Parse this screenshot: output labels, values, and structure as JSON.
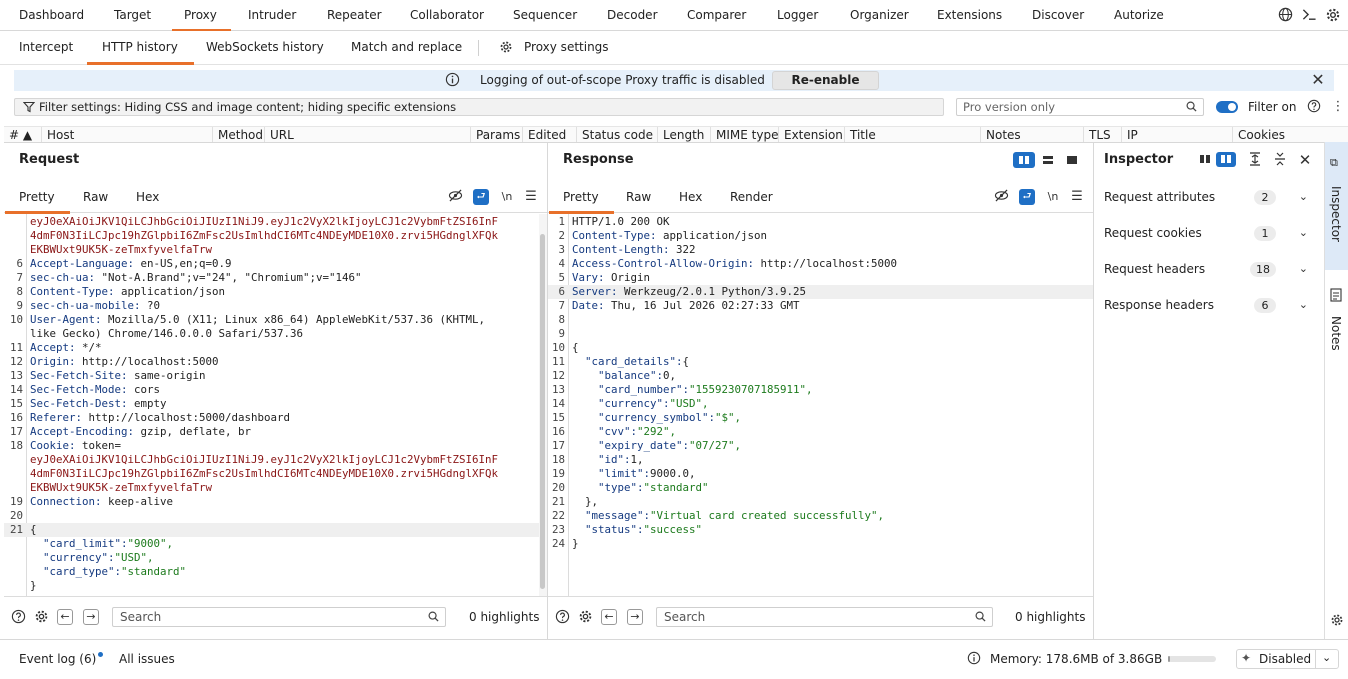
{
  "top_tabs": [
    "Dashboard",
    "Target",
    "Proxy",
    "Intruder",
    "Repeater",
    "Collaborator",
    "Sequencer",
    "Decoder",
    "Comparer",
    "Logger",
    "Organizer",
    "Extensions",
    "Discover",
    "Autorize"
  ],
  "sub_tabs": {
    "intercept": "Intercept",
    "http_history": "HTTP history",
    "websockets": "WebSockets history",
    "match_replace": "Match and replace",
    "proxy_settings": "Proxy settings"
  },
  "banner": {
    "message": "Logging of out-of-scope Proxy traffic is disabled",
    "button": "Re-enable"
  },
  "filter": {
    "label": "Filter settings: Hiding CSS and image content; hiding specific extensions",
    "pro_placeholder": "Pro version only",
    "filter_on": "Filter on"
  },
  "columns": [
    "#",
    "Host",
    "Method",
    "URL",
    "Params",
    "Edited",
    "Status code",
    "Length",
    "MIME type",
    "Extension",
    "Title",
    "Notes",
    "TLS",
    "IP",
    "Cookies"
  ],
  "request": {
    "title": "Request",
    "tabs": {
      "pretty": "Pretty",
      "raw": "Raw",
      "hex": "Hex"
    },
    "newline_icon": "\\n",
    "lines": [
      {
        "n": "",
        "k": "",
        "v": "eyJ0eXAiOiJKV1QiLCJhbGciOiJIUzI1NiJ9.eyJ1c2VyX2lkIjoyLCJ1c2VybmFtZSI6InF",
        "type": "tok"
      },
      {
        "n": "",
        "k": "",
        "v": "4dmF0N3IiLCJpc19hZGlpbiI6ZmFsc2UsImlhdCI6MTc4NDEyMDE10X0.zrvi5HGdnglXFQk",
        "type": "tok"
      },
      {
        "n": "",
        "k": "",
        "v": "EKBWUxt9UK5K-zeTmxfyvelfaTrw",
        "type": "tok"
      },
      {
        "n": "6",
        "k": "Accept-Language:",
        "v": " en-US,en;q=0.9",
        "type": "h"
      },
      {
        "n": "7",
        "k": "sec-ch-ua:",
        "v": " \"Not-A.Brand\";v=\"24\", \"Chromium\";v=\"146\"",
        "type": "h"
      },
      {
        "n": "8",
        "k": "Content-Type:",
        "v": " application/json",
        "type": "h"
      },
      {
        "n": "9",
        "k": "sec-ch-ua-mobile:",
        "v": " ?0",
        "type": "h"
      },
      {
        "n": "10",
        "k": "User-Agent:",
        "v": " Mozilla/5.0 (X11; Linux x86_64) AppleWebKit/537.36 (KHTML,",
        "type": "h"
      },
      {
        "n": "",
        "k": "",
        "v": "like Gecko) Chrome/146.0.0.0 Safari/537.36",
        "type": "p"
      },
      {
        "n": "11",
        "k": "Accept:",
        "v": " */*",
        "type": "h"
      },
      {
        "n": "12",
        "k": "Origin:",
        "v": " http://localhost:5000",
        "type": "h"
      },
      {
        "n": "13",
        "k": "Sec-Fetch-Site:",
        "v": " same-origin",
        "type": "h"
      },
      {
        "n": "14",
        "k": "Sec-Fetch-Mode:",
        "v": " cors",
        "type": "h"
      },
      {
        "n": "15",
        "k": "Sec-Fetch-Dest:",
        "v": " empty",
        "type": "h"
      },
      {
        "n": "16",
        "k": "Referer:",
        "v": " http://localhost:5000/dashboard",
        "type": "h"
      },
      {
        "n": "17",
        "k": "Accept-Encoding:",
        "v": " gzip, deflate, br",
        "type": "h"
      },
      {
        "n": "18",
        "k": "Cookie:",
        "v": " token=",
        "type": "h"
      },
      {
        "n": "",
        "k": "",
        "v": "eyJ0eXAiOiJKV1QiLCJhbGciOiJIUzI1NiJ9.eyJ1c2VyX2lkIjoyLCJ1c2VybmFtZSI6InF",
        "type": "tok"
      },
      {
        "n": "",
        "k": "",
        "v": "4dmF0N3IiLCJpc19hZGlpbiI6ZmFsc2UsImlhdCI6MTc4NDEyMDE10X0.zrvi5HGdnglXFQk",
        "type": "tok"
      },
      {
        "n": "",
        "k": "",
        "v": "EKBWUxt9UK5K-zeTmxfyvelfaTrw",
        "type": "tok"
      },
      {
        "n": "19",
        "k": "Connection:",
        "v": " keep-alive",
        "type": "h"
      },
      {
        "n": "20",
        "k": "",
        "v": "",
        "type": "p"
      },
      {
        "n": "21",
        "k": "",
        "v": "{",
        "type": "p"
      },
      {
        "n": "",
        "k": "  \"card_limit\":",
        "v": "\"9000\",",
        "type": "j"
      },
      {
        "n": "",
        "k": "  \"currency\":",
        "v": "\"USD\",",
        "type": "j"
      },
      {
        "n": "",
        "k": "  \"card_type\":",
        "v": "\"standard\"",
        "type": "j"
      },
      {
        "n": "",
        "k": "",
        "v": "}",
        "type": "p"
      }
    ],
    "search_placeholder": "Search",
    "highlights": "0 highlights"
  },
  "response": {
    "title": "Response",
    "tabs": {
      "pretty": "Pretty",
      "raw": "Raw",
      "hex": "Hex",
      "render": "Render"
    },
    "newline_icon": "\\n",
    "lines": [
      {
        "n": "1",
        "k": "",
        "v": "HTTP/1.0 200 OK",
        "type": "p"
      },
      {
        "n": "2",
        "k": "Content-Type:",
        "v": " application/json",
        "type": "h"
      },
      {
        "n": "3",
        "k": "Content-Length:",
        "v": " 322",
        "type": "h"
      },
      {
        "n": "4",
        "k": "Access-Control-Allow-Origin:",
        "v": " http://localhost:5000",
        "type": "h"
      },
      {
        "n": "5",
        "k": "Vary:",
        "v": " Origin",
        "type": "h"
      },
      {
        "n": "6",
        "k": "Server:",
        "v": " Werkzeug/2.0.1 Python/3.9.25",
        "type": "h"
      },
      {
        "n": "7",
        "k": "Date:",
        "v": " Thu, 16 Jul 2026 02:27:33 GMT",
        "type": "h"
      },
      {
        "n": "8",
        "k": "",
        "v": "",
        "type": "p"
      },
      {
        "n": "9",
        "k": "",
        "v": "",
        "type": "p"
      },
      {
        "n": "10",
        "k": "",
        "v": "{",
        "type": "p"
      },
      {
        "n": "11",
        "k": "  \"card_details\":",
        "v": "{",
        "type": "jp"
      },
      {
        "n": "12",
        "k": "    \"balance\":",
        "v": "0,",
        "type": "jp"
      },
      {
        "n": "13",
        "k": "    \"card_number\":",
        "v": "\"1559230707185911\",",
        "type": "j"
      },
      {
        "n": "14",
        "k": "    \"currency\":",
        "v": "\"USD\",",
        "type": "j"
      },
      {
        "n": "15",
        "k": "    \"currency_symbol\":",
        "v": "\"$\",",
        "type": "j"
      },
      {
        "n": "16",
        "k": "    \"cvv\":",
        "v": "\"292\",",
        "type": "j"
      },
      {
        "n": "17",
        "k": "    \"expiry_date\":",
        "v": "\"07/27\",",
        "type": "j"
      },
      {
        "n": "18",
        "k": "    \"id\":",
        "v": "1,",
        "type": "jp"
      },
      {
        "n": "19",
        "k": "    \"limit\":",
        "v": "9000.0,",
        "type": "jp"
      },
      {
        "n": "20",
        "k": "    \"type\":",
        "v": "\"standard\"",
        "type": "j"
      },
      {
        "n": "21",
        "k": "",
        "v": "  },",
        "type": "p"
      },
      {
        "n": "22",
        "k": "  \"message\":",
        "v": "\"Virtual card created successfully\",",
        "type": "j"
      },
      {
        "n": "23",
        "k": "  \"status\":",
        "v": "\"success\"",
        "type": "j"
      },
      {
        "n": "24",
        "k": "",
        "v": "}",
        "type": "p"
      }
    ],
    "search_placeholder": "Search",
    "highlights": "0 highlights"
  },
  "inspector": {
    "title": "Inspector",
    "rows": [
      {
        "label": "Request attributes",
        "count": "2"
      },
      {
        "label": "Request cookies",
        "count": "1"
      },
      {
        "label": "Request headers",
        "count": "18"
      },
      {
        "label": "Response headers",
        "count": "6"
      }
    ]
  },
  "rail": {
    "inspector": "Inspector",
    "notes": "Notes"
  },
  "status_bar": {
    "event_log": "Event log (6)",
    "all_issues": "All issues",
    "memory": "Memory: 178.6MB of 3.86GB",
    "memory_fraction": 0.05,
    "disabled": "Disabled"
  },
  "colors": {
    "accent": "#e8702a",
    "blue": "#1f6fc5",
    "header_key": "#153a80",
    "json_string": "#1c7a1c",
    "token": "#8a1515"
  }
}
